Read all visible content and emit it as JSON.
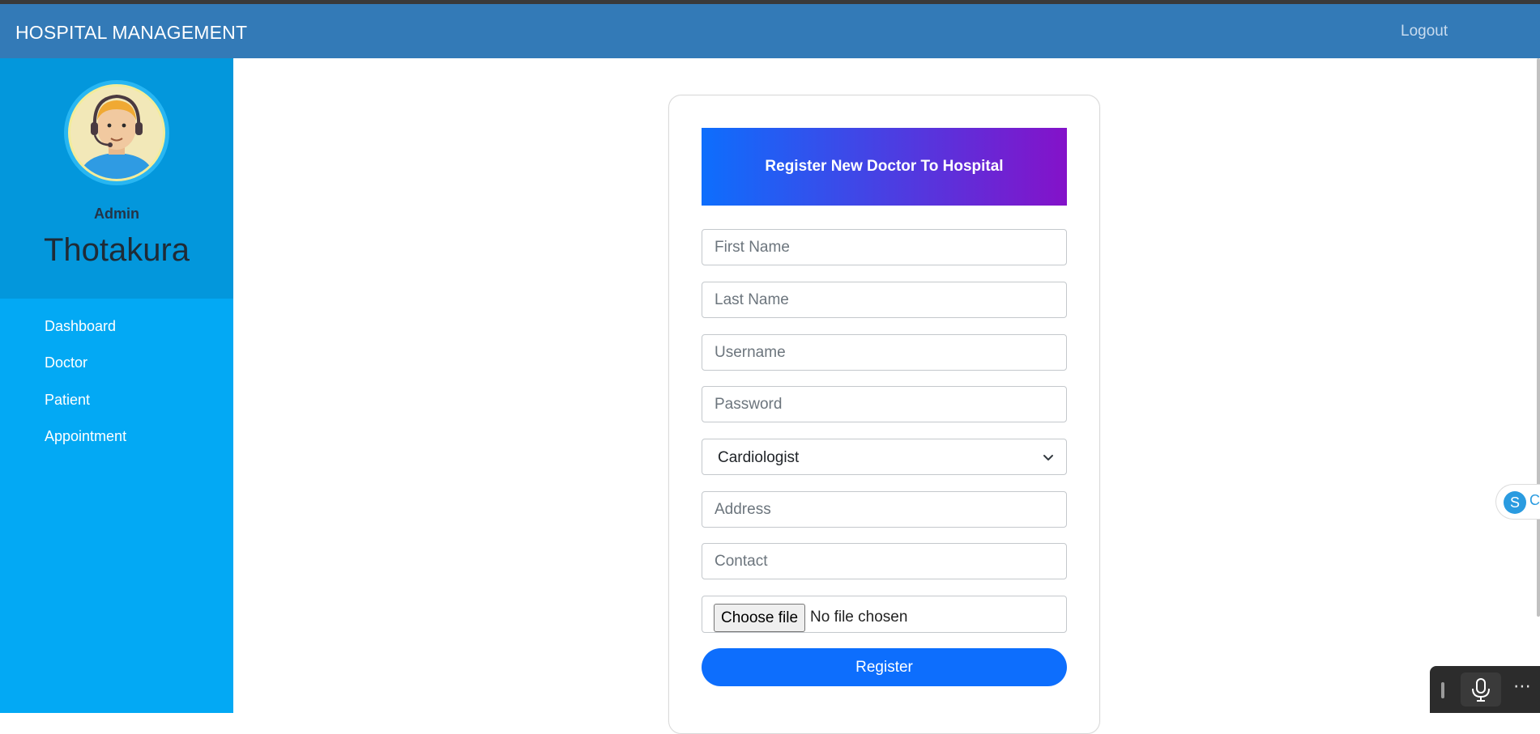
{
  "navbar": {
    "brand": "HOSPITAL MANAGEMENT",
    "logout": "Logout"
  },
  "sidebar": {
    "role": "Admin",
    "username": "Thotakura",
    "items": [
      {
        "label": "Dashboard"
      },
      {
        "label": "Doctor"
      },
      {
        "label": "Patient"
      },
      {
        "label": "Appointment"
      }
    ]
  },
  "form": {
    "title": "Register New Doctor To Hospital",
    "first_name_placeholder": "First Name",
    "last_name_placeholder": "Last Name",
    "username_placeholder": "Username",
    "password_placeholder": "Password",
    "department_selected": "Cardiologist",
    "address_placeholder": "Address",
    "contact_placeholder": "Contact",
    "file_button": "Choose file",
    "file_status": "No file chosen",
    "submit": "Register"
  },
  "widgets": {
    "skype_letter": "S",
    "skype_text": "C"
  },
  "colors": {
    "navbar": "#337ab7",
    "sidebar": "#03a9f4",
    "sidebar_profile": "#0397dc",
    "header_gradient_start": "#0d6efd",
    "header_gradient_end": "#8412c9",
    "primary_button": "#0d6efd"
  },
  "icons": {
    "avatar": "operator-headset-avatar",
    "select": "chevron-down-icon",
    "voice": "microphone-icon",
    "more": "more-horizontal-icon"
  }
}
